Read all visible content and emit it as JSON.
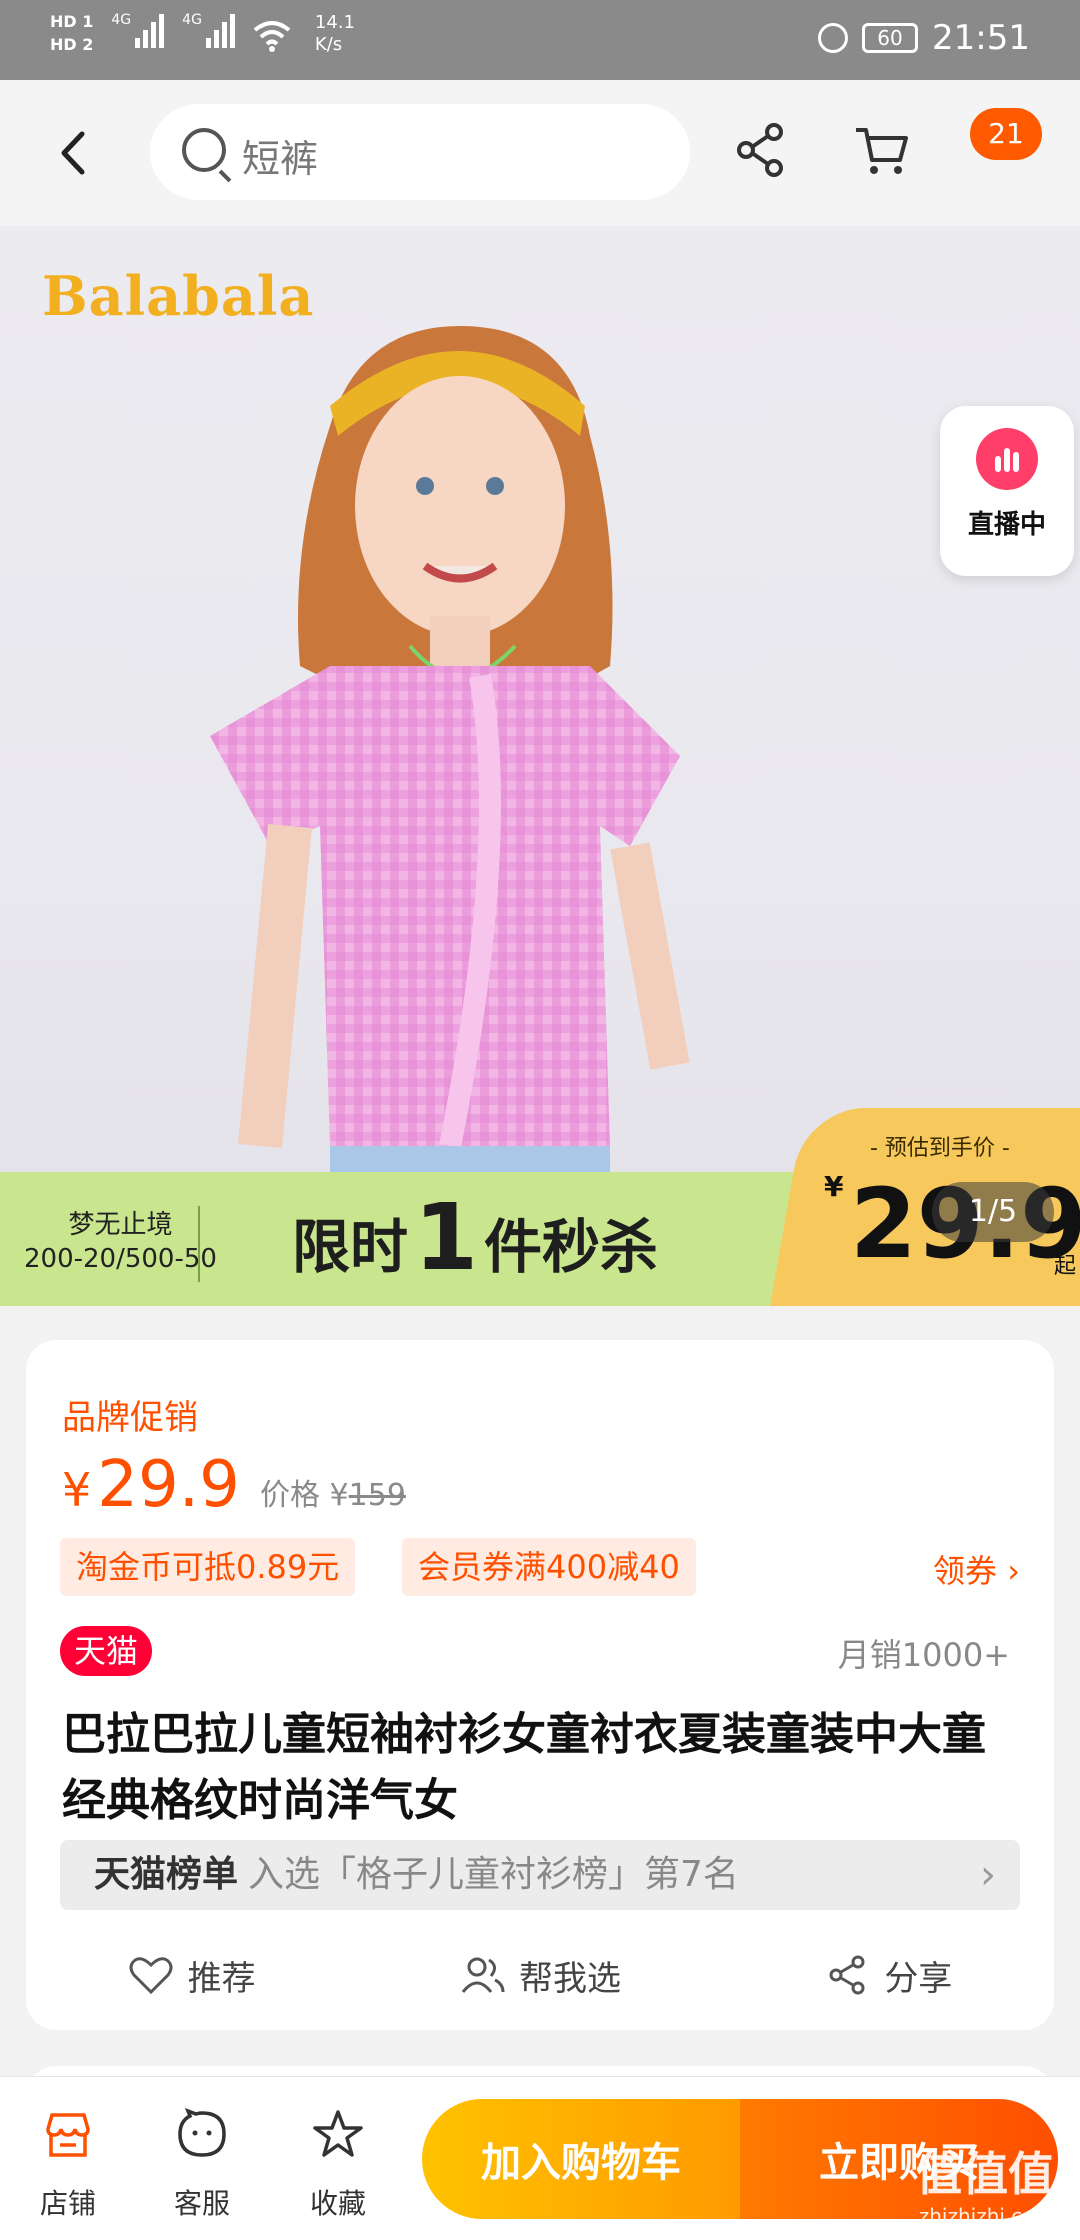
{
  "status_bar": {
    "hd1": "HD",
    "hd1_sim": "1",
    "hd2": "HD",
    "hd2_sim": "2",
    "net1": "4G",
    "net2": "4G",
    "speed_value": "14.1",
    "speed_unit": "K/s",
    "battery": "60",
    "time": "21:51"
  },
  "header": {
    "back_icon": "chevron-left-icon",
    "search_placeholder": "短裤",
    "share_icon": "share-icon",
    "cart_icon": "cart-icon",
    "cart_badge": "21"
  },
  "hero": {
    "brand": "Balabala",
    "live_label": "直播中",
    "promo_left_line1": "梦无止境",
    "promo_left_line2": "200-20/500-50",
    "promo_main_pre": "限时",
    "promo_main_num": "1",
    "promo_main_post": "件秒杀",
    "price_tag_label": "- 预估到手价 -",
    "price_tag_yen": "¥",
    "price_tag_value": "29.9",
    "price_tag_suffix": "起",
    "pager": "1/5"
  },
  "product": {
    "promo_label": "品牌促销",
    "price_yen": "¥",
    "price": "29.9",
    "orig_label": "价格",
    "orig_yen": "¥",
    "orig_price": "159",
    "coupons": [
      "淘金币可抵0.89元",
      "会员券满400减40"
    ],
    "get_coupon": "领券",
    "tmall_tag": "天猫",
    "monthly_sales": "月销1000+",
    "title": "巴拉巴拉儿童短袖衬衫女童衬衣夏装童装中大童经典格纹时尚洋气女",
    "rank_title": "天猫榜单",
    "rank_text": "入选「格子儿童衬衫榜」第7名",
    "actions": [
      {
        "label": "推荐",
        "icon": "heart-icon"
      },
      {
        "label": "帮我选",
        "icon": "people-icon"
      },
      {
        "label": "分享",
        "icon": "share-icon"
      }
    ]
  },
  "bottom_bar": {
    "tabs": [
      {
        "label": "店铺",
        "icon": "store-icon"
      },
      {
        "label": "客服",
        "icon": "chat-icon"
      },
      {
        "label": "收藏",
        "icon": "star-icon"
      }
    ],
    "add_to_cart": "加入购物车",
    "buy_now": "立即购买",
    "watermark_big": "值值值",
    "watermark_small": "zhizhizhi.com"
  },
  "colors": {
    "accent": "#ff5000",
    "tmall_red": "#ff0036",
    "promo_green": "#c9e58e",
    "price_tag_yellow": "#f7c95c"
  }
}
